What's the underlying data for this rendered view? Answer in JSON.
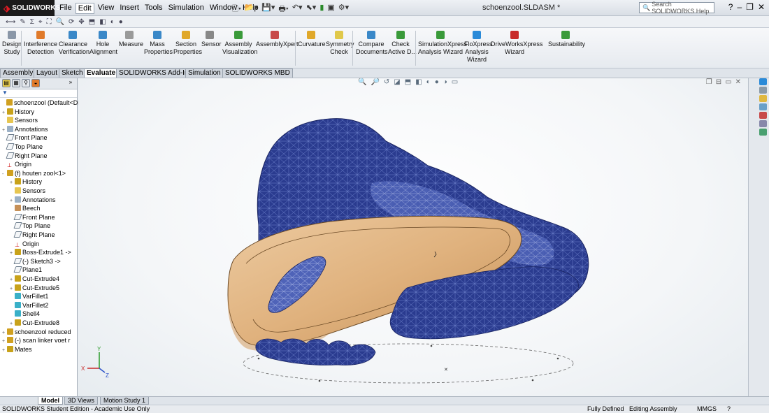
{
  "app": {
    "logo_text": "SOLIDWORKS",
    "document_title": "schoenzool.SLDASM *",
    "help_search_placeholder": "Search SOLIDWORKS Help"
  },
  "menu": [
    "File",
    "Edit",
    "View",
    "Insert",
    "Tools",
    "Simulation",
    "Window",
    "Help"
  ],
  "active_menu": "Edit",
  "command_manager": [
    {
      "label": "Design\nStudy",
      "icon": "design-study-icon"
    },
    {
      "label": "Interference\nDetection",
      "icon": "interference-icon"
    },
    {
      "label": "Clearance\nVerification",
      "icon": "clearance-icon"
    },
    {
      "label": "Hole\nAlignment",
      "icon": "hole-alignment-icon"
    },
    {
      "label": "Measure",
      "icon": "measure-icon"
    },
    {
      "label": "Mass\nProperties",
      "icon": "mass-properties-icon"
    },
    {
      "label": "Section\nProperties",
      "icon": "section-properties-icon"
    },
    {
      "label": "Sensor",
      "icon": "sensor-icon"
    },
    {
      "label": "Assembly\nVisualization",
      "icon": "assembly-visualization-icon"
    },
    {
      "label": "AssemblyXpert",
      "icon": "assemblyxpert-icon"
    },
    {
      "label": "Curvature",
      "icon": "curvature-icon"
    },
    {
      "label": "Symmetry\nCheck",
      "icon": "symmetry-icon"
    },
    {
      "label": "Compare\nDocuments",
      "icon": "compare-icon"
    },
    {
      "label": "Check\nActive D...",
      "icon": "check-icon"
    },
    {
      "label": "SimulationXpress\nAnalysis Wizard",
      "icon": "simulationxpress-icon"
    },
    {
      "label": "FloXpress\nAnalysis\nWizard",
      "icon": "floxpress-icon"
    },
    {
      "label": "DriveWorksXpress\nWizard",
      "icon": "driveworks-icon"
    },
    {
      "label": "Sustainability",
      "icon": "sustainability-icon"
    }
  ],
  "command_tabs": [
    "Assembly",
    "Layout",
    "Sketch",
    "Evaluate",
    "SOLIDWORKS Add-Ins",
    "Simulation",
    "SOLIDWORKS MBD"
  ],
  "active_command_tab": "Evaluate",
  "feature_tree": [
    {
      "label": "schoenzool  (Default<Di",
      "indent": 0,
      "icon": "asm",
      "toggle": ""
    },
    {
      "label": "History",
      "indent": 1,
      "icon": "feat",
      "toggle": "+"
    },
    {
      "label": "Sensors",
      "indent": 1,
      "icon": "sens",
      "toggle": ""
    },
    {
      "label": "Annotations",
      "indent": 1,
      "icon": "annot",
      "toggle": "+"
    },
    {
      "label": "Front Plane",
      "indent": 1,
      "icon": "plane",
      "toggle": ""
    },
    {
      "label": "Top Plane",
      "indent": 1,
      "icon": "plane",
      "toggle": ""
    },
    {
      "label": "Right Plane",
      "indent": 1,
      "icon": "plane",
      "toggle": ""
    },
    {
      "label": "Origin",
      "indent": 1,
      "icon": "origin",
      "toggle": ""
    },
    {
      "label": "(f) houten zool<1>",
      "indent": 1,
      "icon": "asm",
      "toggle": "-"
    },
    {
      "label": "History",
      "indent": 2,
      "icon": "feat",
      "toggle": "+"
    },
    {
      "label": "Sensors",
      "indent": 2,
      "icon": "sens",
      "toggle": ""
    },
    {
      "label": "Annotations",
      "indent": 2,
      "icon": "annot",
      "toggle": "+"
    },
    {
      "label": "Beech",
      "indent": 2,
      "icon": "mat",
      "toggle": ""
    },
    {
      "label": "Front Plane",
      "indent": 2,
      "icon": "plane",
      "toggle": ""
    },
    {
      "label": "Top Plane",
      "indent": 2,
      "icon": "plane",
      "toggle": ""
    },
    {
      "label": "Right Plane",
      "indent": 2,
      "icon": "plane",
      "toggle": ""
    },
    {
      "label": "Origin",
      "indent": 2,
      "icon": "origin",
      "toggle": ""
    },
    {
      "label": "Boss-Extrude1 ->",
      "indent": 2,
      "icon": "feat",
      "toggle": "+"
    },
    {
      "label": "(-) Sketch3 ->",
      "indent": 2,
      "icon": "plane",
      "toggle": ""
    },
    {
      "label": "Plane1",
      "indent": 2,
      "icon": "plane",
      "toggle": ""
    },
    {
      "label": "Cut-Extrude4",
      "indent": 2,
      "icon": "feat",
      "toggle": "+"
    },
    {
      "label": "Cut-Extrude5",
      "indent": 2,
      "icon": "feat",
      "toggle": "+"
    },
    {
      "label": "VarFillet1",
      "indent": 2,
      "icon": "fillet",
      "toggle": ""
    },
    {
      "label": "VarFillet2",
      "indent": 2,
      "icon": "fillet",
      "toggle": ""
    },
    {
      "label": "Shell4",
      "indent": 2,
      "icon": "fillet",
      "toggle": ""
    },
    {
      "label": "Cut-Extrude8",
      "indent": 2,
      "icon": "feat",
      "toggle": "+"
    },
    {
      "label": "schoenzool reduced",
      "indent": 1,
      "icon": "asm",
      "toggle": "+"
    },
    {
      "label": "(-) scan linker voet r",
      "indent": 1,
      "icon": "asm",
      "toggle": "+"
    },
    {
      "label": "Mates",
      "indent": 1,
      "icon": "feat",
      "toggle": "+"
    }
  ],
  "bottom_tabs": [
    "Model",
    "3D Views",
    "Motion Study 1"
  ],
  "active_bottom_tab": "Model",
  "status": {
    "edition": "SOLIDWORKS Student Edition - Academic Use Only",
    "state": "Fully Defined",
    "mode": "Editing Assembly",
    "units": "MMGS"
  },
  "colors": {
    "mesh_blue": "#2a3b8f",
    "mesh_light": "#4f63b8",
    "wood": "#e3b98a",
    "wood_dark": "#c7945c"
  }
}
